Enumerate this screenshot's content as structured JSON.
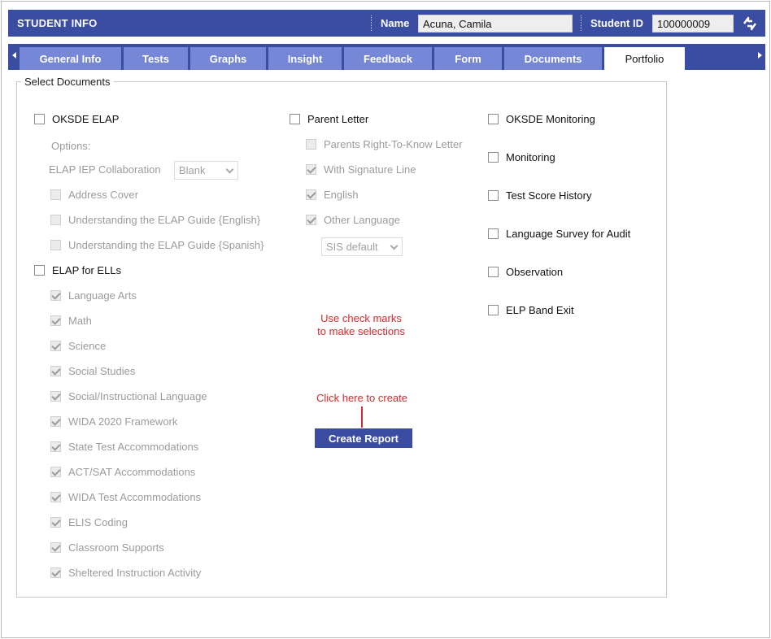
{
  "header": {
    "title": "STUDENT INFO",
    "name_label": "Name",
    "name_value": "Acuna, Camila",
    "student_id_label": "Student ID",
    "student_id_value": "100000009",
    "bg_color": "#3b4da0"
  },
  "tabs": [
    {
      "label": "General Info",
      "active": false
    },
    {
      "label": "Tests",
      "active": false
    },
    {
      "label": "Graphs",
      "active": false
    },
    {
      "label": "Insight",
      "active": false
    },
    {
      "label": "Feedback",
      "active": false
    },
    {
      "label": "Form",
      "active": false
    },
    {
      "label": "Documents",
      "active": false
    },
    {
      "label": "Portfolio",
      "active": true
    }
  ],
  "documents": {
    "legend": "Select Documents",
    "col1": {
      "oksde_elap": "OKSDE ELAP",
      "options_label": "Options:",
      "iep_label": "ELAP IEP Collaboration",
      "iep_select_value": "Blank",
      "address_cover": "Address Cover",
      "guide_english": "Understanding the ELAP Guide {English}",
      "guide_spanish": "Understanding the ELAP Guide {Spanish}",
      "elap_for_ells": "ELAP for ELLs",
      "ell_items": [
        "Language Arts",
        "Math",
        "Science",
        "Social Studies",
        "Social/Instructional Language",
        "WIDA 2020 Framework",
        "State Test Accommodations",
        "ACT/SAT Accommodations",
        "WIDA Test Accommodations",
        "ELIS Coding",
        "Classroom Supports",
        "Sheltered Instruction Activity"
      ]
    },
    "col2": {
      "parent_letter": "Parent Letter",
      "right_to_know": "Parents Right-To-Know Letter",
      "signature_line": "With Signature Line",
      "english": "English",
      "other_language": "Other Language",
      "language_select_value": "SIS default"
    },
    "col3": {
      "items": [
        "OKSDE Monitoring",
        "Monitoring",
        "Test Score History",
        "Language Survey for Audit",
        "Observation",
        "ELP Band Exit"
      ]
    }
  },
  "hints": {
    "check_marks_line1": "Use check marks",
    "check_marks_line2": "to make selections",
    "click_here": "Click here to create",
    "color": "#d42a2a"
  },
  "create_report_label": "Create Report"
}
